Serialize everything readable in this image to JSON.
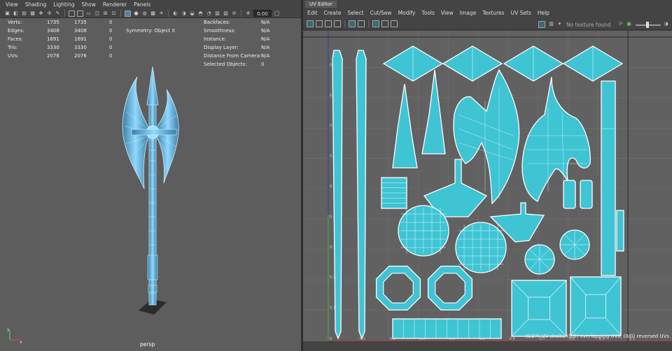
{
  "viewport": {
    "menu": [
      "View",
      "Shading",
      "Lighting",
      "Show",
      "Renderer",
      "Panels"
    ],
    "zoom_value": "0.00",
    "hud": {
      "rows": [
        {
          "label": "Verts:",
          "a": "1735",
          "b": "1735",
          "c": "0"
        },
        {
          "label": "Edges:",
          "a": "3408",
          "b": "3408",
          "c": "0"
        },
        {
          "label": "Faces:",
          "a": "1691",
          "b": "1691",
          "c": "0"
        },
        {
          "label": "Tris:",
          "a": "3330",
          "b": "3330",
          "c": "0"
        },
        {
          "label": "UVs:",
          "a": "2076",
          "b": "2076",
          "c": "0"
        }
      ],
      "symmetry": "Symmetry: Object X",
      "right_rows": [
        {
          "label": "Backfaces:",
          "value": "N/A"
        },
        {
          "label": "Smoothness:",
          "value": "N/A"
        },
        {
          "label": "Instance:",
          "value": "N/A"
        },
        {
          "label": "Display Layer:",
          "value": "N/A"
        },
        {
          "label": "Distance From Camera:",
          "value": "N/A"
        },
        {
          "label": "Selected Objects:",
          "value": "0"
        }
      ]
    },
    "camera": "persp",
    "axis_x": "x",
    "axis_y": "y"
  },
  "uv_editor": {
    "tab": "UV Editor",
    "menu": [
      "Edit",
      "Create",
      "Select",
      "Cut/Sew",
      "Modify",
      "Tools",
      "View",
      "Image",
      "Textures",
      "UV Sets",
      "Help"
    ],
    "texture_status": "No texture found",
    "status": "(0/27) UV shells, (0/0) overlapping UVs, (0/0) reversed UVs",
    "axis_labels_y": [
      "0.9",
      "0.8",
      "0.7",
      "0.6",
      "0.5",
      "0.4",
      "0.3",
      "0.2",
      "0.1"
    ],
    "axis_labels_x": [
      "0",
      "0.1",
      "0.2",
      "0.3",
      "0.4",
      "0.5",
      "0.6",
      "0.7",
      "0.8",
      "0.9",
      "1.1"
    ]
  },
  "colors": {
    "uv_fill": "#3fc4d4",
    "uv_outline": "#ffffff",
    "viewport_bg": "#5d5d5d",
    "uv_bg": "#616161",
    "mesh_blue": "#6ecbf0"
  }
}
